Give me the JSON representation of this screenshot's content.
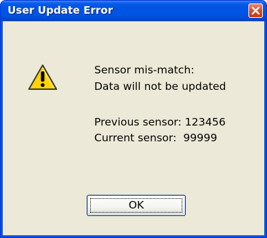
{
  "window": {
    "title": "User Update Error",
    "close_icon": "close-icon"
  },
  "message": {
    "line1": "Sensor mis-match:",
    "line2": "Data will not be updated",
    "line3": "Previous sensor: 123456",
    "line4": "Current sensor:  99999"
  },
  "buttons": {
    "ok_label": "OK"
  },
  "icons": {
    "warning": "warning-icon"
  },
  "colors": {
    "titlebar": "#0054e3",
    "client_background": "#ece9d8",
    "close_button": "#d9512c",
    "warning_fill": "#ffd400"
  }
}
